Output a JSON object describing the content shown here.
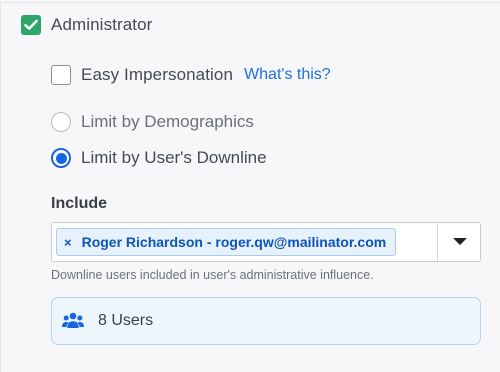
{
  "admin": {
    "label": "Administrator",
    "checked": true
  },
  "impersonation": {
    "label": "Easy Impersonation",
    "checked": false,
    "help_link": "What's this?"
  },
  "limit_options": [
    {
      "label": "Limit by Demographics",
      "selected": false
    },
    {
      "label": "Limit by User's Downline",
      "selected": true
    }
  ],
  "include": {
    "label": "Include",
    "tags": [
      {
        "text": "Roger Richardson - roger.qw@mailinator.com",
        "remove": "×"
      }
    ],
    "help_text": "Downline users included in user's administrative influence."
  },
  "users_summary": {
    "text": "8 Users",
    "icon": "users-icon"
  },
  "colors": {
    "checkbox_checked": "#2ea66b",
    "accent_blue": "#1764e3",
    "link_blue": "#1d6fd8",
    "tag_bg": "#e6f1fc",
    "summary_bg": "#edf5fd"
  }
}
